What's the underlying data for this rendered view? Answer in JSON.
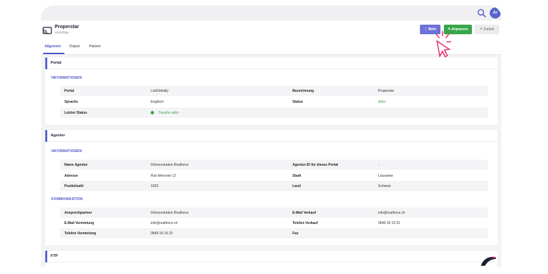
{
  "topbar": {
    "avatar_initials": "Ar"
  },
  "header": {
    "title": "Properstar",
    "subtitle": "vorschau",
    "buttons": {
      "more": "Mehr",
      "edit": "Anpassen",
      "back": "Zurück"
    }
  },
  "tabs": [
    {
      "label": "Allgemein"
    },
    {
      "label": "Output"
    },
    {
      "label": "Historie"
    }
  ],
  "portal": {
    "title": "Portal",
    "section": "INFORMATIONEN",
    "rows": [
      {
        "k1": "Portal",
        "v1": "ListGlobally",
        "k2": "Bezeichnung",
        "v2": "Properstar"
      },
      {
        "k1": "Sprache",
        "v1": "Englisch",
        "k2": "Status",
        "v2": "Aktiv"
      },
      {
        "k1": "Letzter Status",
        "v1": "Transfer aktiv",
        "k2": "",
        "v2": ""
      }
    ]
  },
  "agent": {
    "title": "Agenter",
    "section_info": "INFORMATIONEN",
    "info_rows": [
      {
        "k1": "Name Agentur",
        "v1": "Démonstration Realforce",
        "k2": "Agentur-ID für dieses Portal",
        "v2": "-"
      },
      {
        "k1": "Adresse",
        "v1": "Rue Mercerie 12",
        "k2": "Stadt",
        "v2": "Lousanne"
      },
      {
        "k1": "Postleitzahl",
        "v1": "1003",
        "k2": "Land",
        "v2": "Schweiz"
      }
    ],
    "section_comm": "KOMMUNIKATION",
    "comm_rows": [
      {
        "k1": "Ansprechpartner",
        "v1": "Démonstration Realforce",
        "k2": "E-Mail Verkauf",
        "v2": "info@realforce.ch"
      },
      {
        "k1": "E-Mail Vermietung",
        "v1": "info@realforce.ch",
        "k2": "Telefon Verkauf",
        "v2": "0848 18 19 20"
      },
      {
        "k1": "Telefon Vermietung",
        "v1": "0848 18 19 20",
        "k2": "Fax",
        "v2": ""
      }
    ]
  },
  "ftp": {
    "title": "FTP"
  },
  "colors": {
    "accent": "#4a56c6",
    "success": "#3aa64a",
    "cursor": "#e8336d"
  }
}
